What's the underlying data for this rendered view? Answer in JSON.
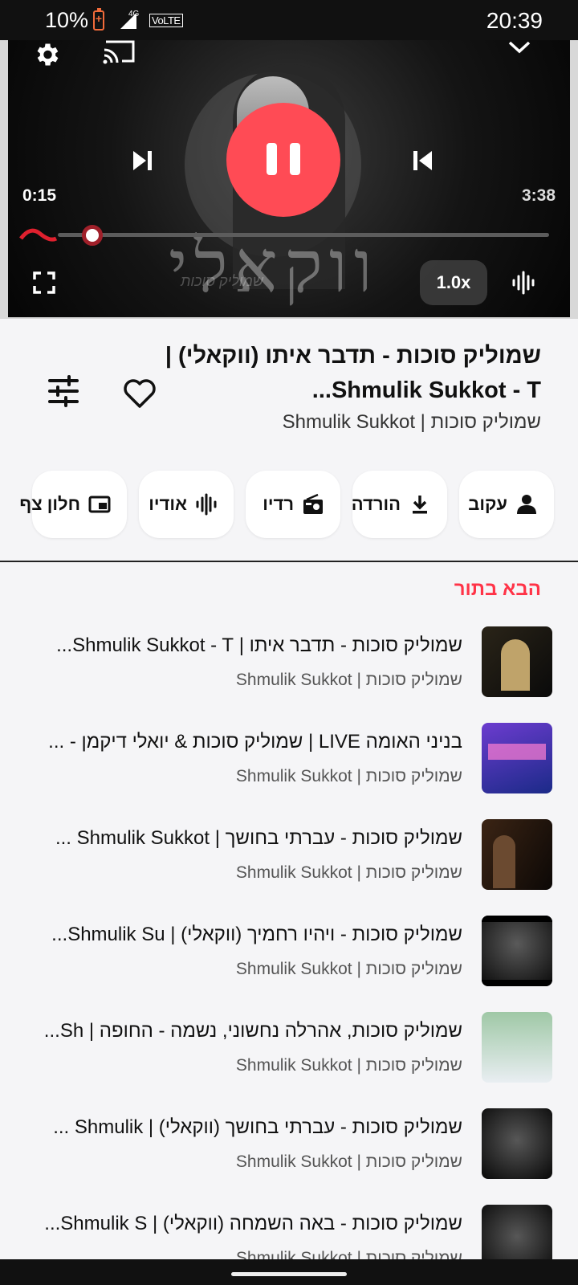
{
  "status_bar": {
    "battery": "10%",
    "network": "4G",
    "volte": "VoLTE",
    "time": "20:39"
  },
  "player": {
    "elapsed": "0:15",
    "total": "3:38",
    "progress": 0.07,
    "speed": "1.0x",
    "is_playing": true,
    "art_text": "ווקאלי",
    "art_signature": "שמוליק סוכות"
  },
  "track": {
    "title": "שמוליק סוכות - תדבר איתו (ווקאלי) | Shmulik Sukkot - T...",
    "artist": "שמוליק סוכות | Shmulik Sukkot",
    "liked": false
  },
  "actions": [
    {
      "label": "עקוב",
      "icon": "person-icon"
    },
    {
      "label": "הורדה",
      "icon": "download-icon"
    },
    {
      "label": "רדיו",
      "icon": "radio-icon"
    },
    {
      "label": "אודיו",
      "icon": "audio-wave-icon"
    },
    {
      "label": "חלון צף",
      "icon": "picture-in-picture-icon"
    }
  ],
  "queue": {
    "heading": "הבא בתור",
    "items": [
      {
        "title": "שמוליק סוכות - תדבר איתו | Shmulik Sukkot - T...",
        "artist": "שמוליק סוכות | Shmulik Sukkot"
      },
      {
        "title": "בניני האומה LIVE | שמוליק סוכות & יואלי דיקמן - ...",
        "artist": "שמוליק סוכות | Shmulik Sukkot"
      },
      {
        "title": "שמוליק סוכות - עברתי בחושך | Shmulik Sukkot ...",
        "artist": "שמוליק סוכות | Shmulik Sukkot"
      },
      {
        "title": "שמוליק סוכות - ויהיו רחמיך (ווקאלי) | Shmulik Su...",
        "artist": "שמוליק סוכות | Shmulik Sukkot"
      },
      {
        "title": "שמוליק סוכות, אהרלה נחשוני, נשמה - החופה | Sh...",
        "artist": "שמוליק סוכות | Shmulik Sukkot"
      },
      {
        "title": "שמוליק סוכות - עברתי בחושך (ווקאלי) | Shmulik ...",
        "artist": "שמוליק סוכות | Shmulik Sukkot"
      },
      {
        "title": "שמוליק סוכות - באה השמחה (ווקאלי) | Shmulik S...",
        "artist": "שמוליק סוכות | Shmulik Sukkot"
      }
    ]
  },
  "colors": {
    "accent": "#ff3347",
    "play_button": "#ff4b55",
    "background": "#f5f5f7"
  }
}
